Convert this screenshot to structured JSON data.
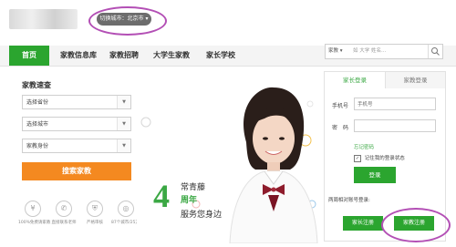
{
  "header": {
    "city_button": "切换城市：北京市 ▾"
  },
  "nav": {
    "items": [
      "首页",
      "家教信息库",
      "家教招聘",
      "大学生家教",
      "家长学校"
    ]
  },
  "search": {
    "type": "家教 ▾",
    "placeholder": "如 大学 姓名..."
  },
  "quick": {
    "title": "家教速查",
    "select_province": "选择省份",
    "select_city": "选择城市",
    "select_identity": "家教身份",
    "search_button": "搜索家教",
    "features": [
      "100%免费请家教",
      "直接联系老师",
      "严格审核",
      "87个城市/25万用户"
    ]
  },
  "banner": {
    "num": "4",
    "line1": "常青藤",
    "line2": "周年",
    "line3": "服务您身边"
  },
  "login": {
    "tab_parent": "家长登录",
    "tab_teacher": "家教登录",
    "phone_label": "手机号",
    "phone_placeholder": "手机号",
    "password_label": "密　码",
    "forgot": "忘记密码",
    "remember": "记住我的登录状态",
    "login_button": "登录",
    "week_text": "两周相对账号登录:",
    "register_parent": "家长注册",
    "register_teacher": "家教注册"
  },
  "colors": {
    "brand_green": "#2ba52f",
    "accent_orange": "#f48920",
    "highlight_purple": "#b34fb5"
  }
}
